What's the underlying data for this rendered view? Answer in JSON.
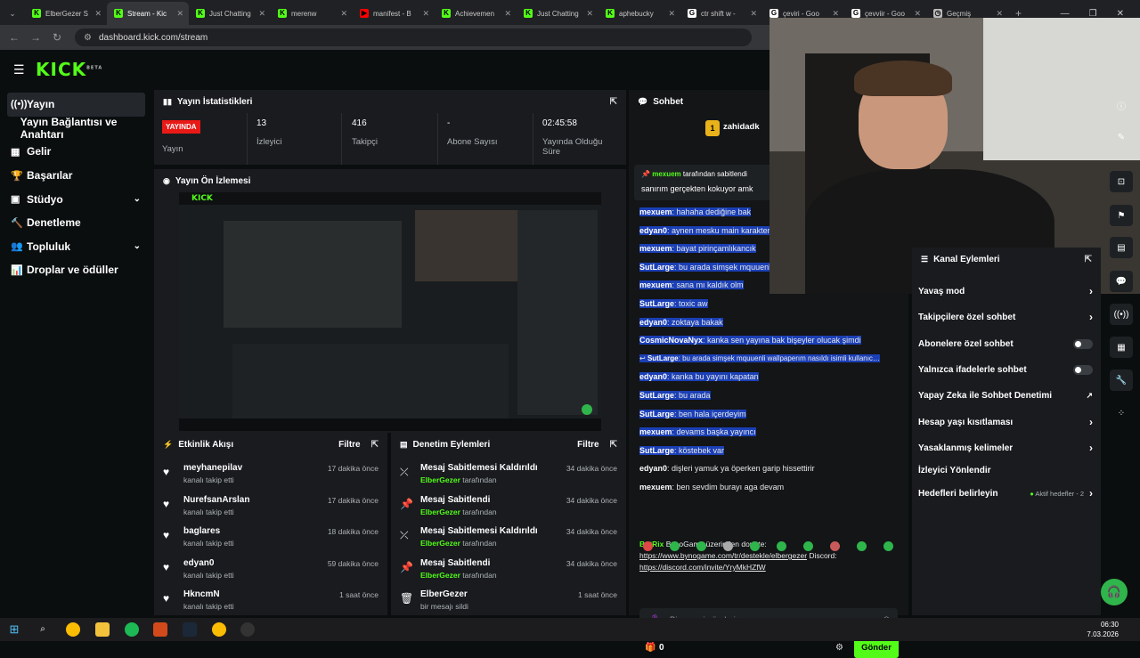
{
  "browser": {
    "tabs": [
      {
        "title": "ElberGezer S",
        "color": "#53fc18",
        "glyph": "K"
      },
      {
        "title": "Stream - Kic",
        "color": "#53fc18",
        "glyph": "K",
        "active": true
      },
      {
        "title": "Just Chatting",
        "color": "#53fc18",
        "glyph": "K"
      },
      {
        "title": "merenw",
        "color": "#53fc18",
        "glyph": "K"
      },
      {
        "title": "manifest - B",
        "color": "#ff0000",
        "glyph": "▶"
      },
      {
        "title": "Achievemen",
        "color": "#53fc18",
        "glyph": "K"
      },
      {
        "title": "Just Chatting",
        "color": "#53fc18",
        "glyph": "K"
      },
      {
        "title": "aphebucky",
        "color": "#53fc18",
        "glyph": "K"
      },
      {
        "title": "ctr shift w -",
        "color": "#ffffff",
        "glyph": "G"
      },
      {
        "title": "çeviri - Goo",
        "color": "#ffffff",
        "glyph": "G"
      },
      {
        "title": "çevviir - Goo",
        "color": "#ffffff",
        "glyph": "G"
      },
      {
        "title": "Geçmiş",
        "color": "#bbbbbb",
        "glyph": "◷"
      }
    ],
    "url": "dashboard.kick.com/stream"
  },
  "brand": {
    "logo": "KICK",
    "beta": "BETA"
  },
  "sidebar": [
    {
      "label": "Yayın",
      "icon": "((•))",
      "active": true
    },
    {
      "label": "Yayın Bağlantısı ve Anahtarı",
      "icon": ""
    },
    {
      "label": "Gelir",
      "icon": "▦"
    },
    {
      "label": "Başarılar",
      "icon": "🏆"
    },
    {
      "label": "Stüdyo",
      "icon": "▣",
      "chevron": true
    },
    {
      "label": "Denetleme",
      "icon": "🔨"
    },
    {
      "label": "Topluluk",
      "icon": "👥",
      "chevron": true
    },
    {
      "label": "Droplar ve ödüller",
      "icon": "📊"
    }
  ],
  "stats": {
    "title": "Yayın İstatistikleri",
    "live_badge": "YAYINDA",
    "items": [
      {
        "value": "",
        "label": "Yayın"
      },
      {
        "value": "13",
        "label": "İzleyici"
      },
      {
        "value": "416",
        "label": "Takipçi"
      },
      {
        "value": "-",
        "label": "Abone Sayısı"
      },
      {
        "value": "02:45:58",
        "label": "Yayında Olduğu Süre"
      }
    ]
  },
  "preview": {
    "title": "Yayın Ön İzlemesi"
  },
  "activity": {
    "title": "Etkinlik Akışı",
    "filter": "Filtre",
    "items": [
      {
        "name": "meyhanepilav",
        "sub": "kanalı takip etti",
        "time": "17 dakika önce"
      },
      {
        "name": "NurefsanArslan",
        "sub": "kanalı takip etti",
        "time": "17 dakika önce"
      },
      {
        "name": "baglares",
        "sub": "kanalı takip etti",
        "time": "18 dakika önce"
      },
      {
        "name": "edyan0",
        "sub": "kanalı takip etti",
        "time": "59 dakika önce"
      },
      {
        "name": "HkncmN",
        "sub": "kanalı takip etti",
        "time": "1 saat önce"
      }
    ]
  },
  "moderation": {
    "title": "Denetim Eylemleri",
    "filter": "Filtre",
    "items": [
      {
        "action": "Mesaj Sabitlemesi Kaldırıldı",
        "by": "ElberGezer",
        "suffix": "tarafından",
        "time": "34 dakika önce",
        "icon": "⤫"
      },
      {
        "action": "Mesaj Sabitlendi",
        "by": "ElberGezer",
        "suffix": "tarafından",
        "time": "34 dakika önce",
        "icon": "📌"
      },
      {
        "action": "Mesaj Sabitlemesi Kaldırıldı",
        "by": "ElberGezer",
        "suffix": "tarafından",
        "time": "34 dakika önce",
        "icon": "⤫"
      },
      {
        "action": "Mesaj Sabitlendi",
        "by": "ElberGezer",
        "suffix": "tarafından",
        "time": "34 dakika önce",
        "icon": "📌"
      },
      {
        "action": "ElberGezer",
        "by": "",
        "suffix": "bir mesajı sildi",
        "time": "1 saat önce",
        "icon": "🗑"
      }
    ]
  },
  "chat": {
    "title": "Sohbet",
    "top_user": "zahidadk",
    "top_rank": "1",
    "pinned_by": "mexuem",
    "pinned_suffix": "tarafından sabitlendi",
    "pinned_text": "sanırım gerçekten kokuyor amk",
    "messages": [
      {
        "user": "mexuem",
        "text": "hahaha dediğine bak"
      },
      {
        "user": "edyan0",
        "text": "aynen mesku main karakter sensin"
      },
      {
        "user": "mexuem",
        "text": "bayat pirinçamlıkancık"
      },
      {
        "user": "SutLarge",
        "text": "bu arada simşek mquuenli wallpaperım nasıldı"
      },
      {
        "user": "mexuem",
        "text": "sana mı kaldık olm"
      },
      {
        "user": "SutLarge",
        "text": "toxic aw"
      },
      {
        "user": "edyan0",
        "text": "zoktaya bakak"
      },
      {
        "user": "CosmicNovaNyx",
        "text": "kanka sen yayına bak bişeyler olucak şimdi"
      },
      {
        "user": "SutLarge",
        "text": "bu arada simşek mquuenli wallpaperım nasıldı isimli kullanıc…",
        "reply": true
      },
      {
        "user": "edyan0",
        "text": "kanka bu yayını kapatan"
      },
      {
        "user": "SutLarge",
        "text": "bu arada"
      },
      {
        "user": "SutLarge",
        "text": "ben hala içerdeyim"
      },
      {
        "user": "mexuem",
        "text": "devams başka yayıncı"
      },
      {
        "user": "SutLarge",
        "text": "köstebek var"
      },
      {
        "user": "edyan0",
        "text": "dişleri yamuk ya öperken garip hissettirir"
      },
      {
        "user": "mexuem",
        "text": "ben sevdim burayı aga devam"
      }
    ],
    "bot_user": "BotRix",
    "bot_text": "BynoGame üzerinden donate:",
    "bot_link1": "https://www.bynogame.com/tr/destekle/elbergezer",
    "bot_link_label": "Discord:",
    "bot_link2": "https://discord.com/invite/YryMkHZfW",
    "input_placeholder": "Bir mesaj gönderin",
    "points": "0",
    "send_label": "Gönder"
  },
  "channel_actions": {
    "title": "Kanal Eylemleri",
    "rows": [
      {
        "label": "Yavaş mod",
        "kind": "chevron"
      },
      {
        "label": "Takipçilere özel sohbet",
        "kind": "chevron"
      },
      {
        "label": "Abonelere özel sohbet",
        "kind": "toggle"
      },
      {
        "label": "Yalnızca ifadelerle sohbet",
        "kind": "toggle"
      },
      {
        "label": "Yapay Zeka ile Sohbet Denetimi",
        "kind": "external"
      },
      {
        "label": "Hesap yaşı kısıtlaması",
        "kind": "chevron"
      },
      {
        "label": "Yasaklanmış kelimeler",
        "kind": "chevron"
      },
      {
        "label": "İzleyici Yönlendir",
        "kind": "none"
      },
      {
        "label": "Hedefleri belirleyin",
        "kind": "goal",
        "extra": "Aktif hedefler - 2"
      }
    ]
  },
  "taskbar": {
    "time": "06:30",
    "date": "7.03.2026"
  }
}
